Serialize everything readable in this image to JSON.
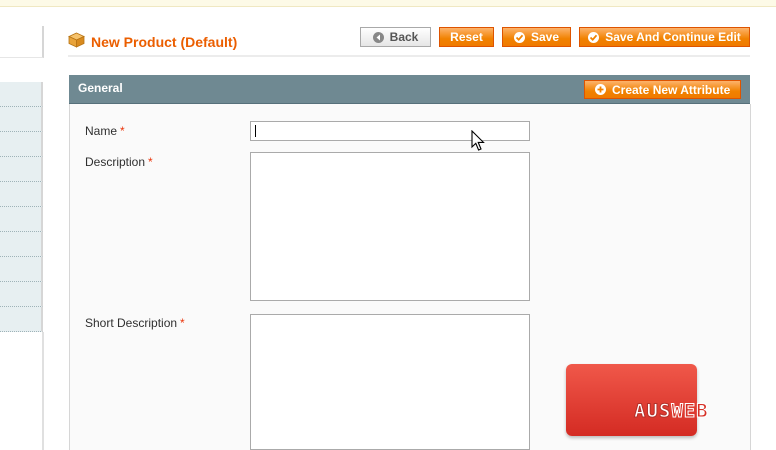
{
  "page": {
    "title": "New Product (Default)"
  },
  "toolbar": {
    "back_label": "Back",
    "reset_label": "Reset",
    "save_label": "Save",
    "save_continue_label": "Save And Continue Edit"
  },
  "section": {
    "title": "General",
    "create_attribute_label": "Create New Attribute"
  },
  "fields": {
    "name": {
      "label": "Name",
      "required": "*",
      "value": ""
    },
    "description": {
      "label": "Description",
      "required": "*",
      "value": ""
    },
    "short_description": {
      "label": "Short Description",
      "required": "*",
      "value": ""
    }
  },
  "watermark": {
    "part1": "AUS",
    "part2": "WEB"
  },
  "colors": {
    "accent": "#eb5e00",
    "button": "#f18200",
    "section_header": "#6f8992",
    "required": "#eb340a"
  },
  "icons": {
    "title": "product-box-icon",
    "back": "back-arrow-icon",
    "save": "checkmark-icon",
    "attribute": "plus-icon",
    "cursor": "mouse-pointer-icon"
  }
}
